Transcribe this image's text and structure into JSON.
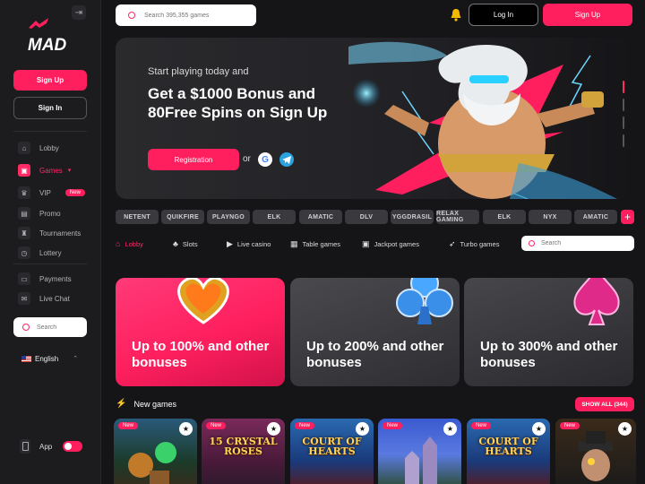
{
  "sidebar": {
    "logo": "MAD",
    "signup": "Sign Up",
    "signin": "Sign In",
    "nav": [
      {
        "label": "Lobby",
        "icon": "home-icon"
      },
      {
        "label": "Games",
        "icon": "games-icon"
      },
      {
        "label": "VIP",
        "icon": "crown-icon",
        "badge": "New"
      },
      {
        "label": "Promo",
        "icon": "gift-icon"
      },
      {
        "label": "Tournaments",
        "icon": "trophy-icon"
      },
      {
        "label": "Lottery",
        "icon": "ticket-icon"
      },
      {
        "label": "Payments",
        "icon": "wallet-icon"
      },
      {
        "label": "Live Chat",
        "icon": "chat-icon"
      }
    ],
    "search_placeholder": "Search",
    "language": "English",
    "app_label": "App"
  },
  "header": {
    "search_placeholder": "Search 395,355 games",
    "login": "Log In",
    "signup": "Sign Up"
  },
  "hero": {
    "subtitle": "Start playing today and",
    "title": "Get a $1000 Bonus and 80Free Spins on Sign Up",
    "cta": "Registration",
    "or": "or"
  },
  "providers": [
    "NETENT",
    "QUIKFIRE",
    "PLAYNGO",
    "ELK",
    "AMATIC",
    "DLV",
    "YGGDRASIL",
    "RELAX GAMING",
    "ELK",
    "NYX",
    "AMATIC"
  ],
  "categories": {
    "tabs": [
      {
        "label": "Lobby",
        "icon": "home-icon"
      },
      {
        "label": "Slots",
        "icon": "cherry-icon"
      },
      {
        "label": "Live casino",
        "icon": "live-icon"
      },
      {
        "label": "Table games",
        "icon": "cards-icon"
      },
      {
        "label": "Jackpot games",
        "icon": "jackpot-icon"
      },
      {
        "label": "Turbo games",
        "icon": "rocket-icon"
      }
    ],
    "search_placeholder": "Search"
  },
  "bonuses": [
    {
      "text": "Up to 100% and other bonuses",
      "icon": "heart-icon"
    },
    {
      "text": "Up to 200% and other bonuses",
      "icon": "club-icon"
    },
    {
      "text": "Up to 300% and other bonuses",
      "icon": "spade-icon"
    }
  ],
  "new_games": {
    "title": "New games",
    "show_all": "SHOW ALL (344)",
    "items": [
      {
        "badge": "New",
        "name": ""
      },
      {
        "badge": "New",
        "name": "15 CRYSTAL ROSES"
      },
      {
        "badge": "New",
        "name": "COURT OF HEARTS"
      },
      {
        "badge": "New",
        "name": ""
      },
      {
        "badge": "New",
        "name": "COURT OF HEARTS"
      },
      {
        "badge": "New",
        "name": ""
      }
    ]
  },
  "colors": {
    "accent": "#ff1f5e",
    "background": "#151517",
    "sidebar": "#1c1c1f"
  }
}
